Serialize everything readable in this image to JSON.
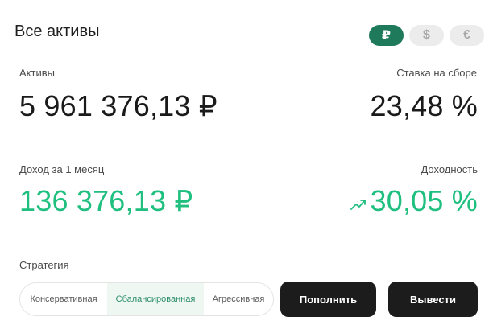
{
  "header": {
    "title": "Все активы"
  },
  "currencies": [
    {
      "symbol": "₽",
      "active": true
    },
    {
      "symbol": "$",
      "active": false
    },
    {
      "symbol": "€",
      "active": false
    }
  ],
  "metrics": {
    "assets": {
      "label": "Активы",
      "value": "5 961 376,13 ₽"
    },
    "collection_rate": {
      "label": "Ставка на сборе",
      "value": "23,48 %"
    },
    "monthly_income": {
      "label": "Доход за 1 месяц",
      "value": "136 376,13 ₽"
    },
    "yield": {
      "label": "Доходность",
      "value": "30,05 %",
      "trend_icon": "trend-up-icon"
    }
  },
  "strategy": {
    "label": "Стратегия",
    "options": [
      "Консервативная",
      "Сбалансированная",
      "Агрессивная"
    ],
    "selected": "Сбалансированная"
  },
  "actions": {
    "topup_label": "Пополнить",
    "withdraw_label": "Вывести"
  },
  "colors": {
    "accent": "#1f7a5b",
    "positive": "#1fbf7f",
    "button_dark": "#1c1c1c"
  }
}
